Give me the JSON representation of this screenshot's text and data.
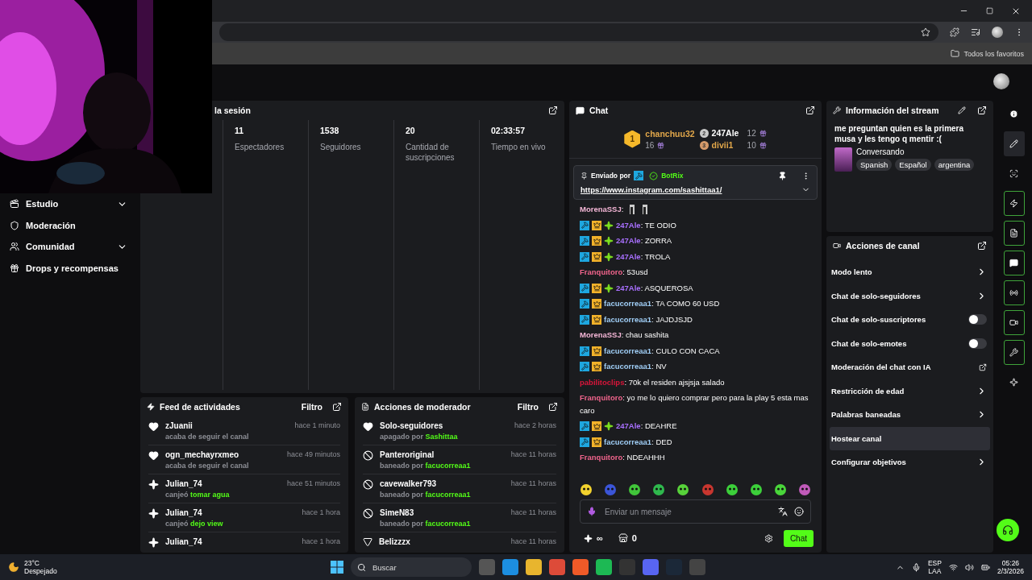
{
  "browser": {
    "bookmark": "Todos los favoritos"
  },
  "sidebar": {
    "items": [
      {
        "label": "Estudio",
        "kind": "group"
      },
      {
        "label": "Moderación",
        "kind": "link"
      },
      {
        "label": "Comunidad",
        "kind": "group"
      },
      {
        "label": "Drops y recompensas",
        "kind": "link"
      }
    ]
  },
  "stats": {
    "title": "la sesión",
    "items": [
      {
        "value": "11",
        "label": "Espectadores"
      },
      {
        "value": "1538",
        "label": "Seguidores"
      },
      {
        "value": "20",
        "label": "Cantidad de suscripciones"
      },
      {
        "value": "02:33:57",
        "label": "Tiempo en vivo"
      }
    ]
  },
  "feed": {
    "title": "Feed de actividades",
    "filter": "Filtro",
    "items": [
      {
        "kind": "follow",
        "user": "zJuanii",
        "time": "hace 1 minuto",
        "action": "acaba de seguir el canal"
      },
      {
        "kind": "follow",
        "user": "ogn_mechayrxmeo",
        "time": "hace 49 minutos",
        "action": "acaba de seguir el canal"
      },
      {
        "kind": "redeem",
        "user": "Julian_74",
        "time": "hace 51 minutos",
        "action": "canjeó",
        "target": "tomar agua"
      },
      {
        "kind": "redeem",
        "user": "Julian_74",
        "time": "hace 1 hora",
        "action": "canjeó",
        "target": "dejo view"
      },
      {
        "kind": "redeem",
        "user": "Julian_74",
        "time": "hace 1 hora"
      }
    ]
  },
  "mod_actions": {
    "title": "Acciones de moderador",
    "filter": "Filtro",
    "items": [
      {
        "kind": "follow",
        "user": "Solo-seguidores",
        "time": "hace 2 horas",
        "action": "apagado por",
        "target": "Sashittaa"
      },
      {
        "kind": "ban",
        "user": "Panteroriginal",
        "time": "hace 11 horas",
        "action": "baneado por",
        "target": "facucorreaa1"
      },
      {
        "kind": "ban",
        "user": "cavewalker793",
        "time": "hace 11 horas",
        "action": "baneado por",
        "target": "facucorreaa1"
      },
      {
        "kind": "ban",
        "user": "SimeN83",
        "time": "hace 11 horas",
        "action": "baneado por",
        "target": "facucorreaa1"
      },
      {
        "kind": "unban",
        "user": "Belizzzx",
        "time": "hace 11 horas"
      }
    ]
  },
  "chat": {
    "title": "Chat",
    "leaders": [
      {
        "rank": "1",
        "name": "chanchuu32",
        "count": "16",
        "color": "#f5b82a"
      },
      {
        "rank": "2",
        "name": "247Ale",
        "count": "12",
        "color": "#c9c9c9"
      },
      {
        "rank": "3",
        "name": "divii1",
        "count": "10",
        "color": "#d59a6a"
      }
    ],
    "pinned": {
      "label": "Enviado por",
      "sender": "BotRix",
      "link": "https://www.instagram.com/sashittaa1/"
    },
    "messages": [
      {
        "user": "MorenaSSJ",
        "color": "#f4b6d6",
        "kind": "emote",
        "text": ":"
      },
      {
        "user": "247Ale",
        "color": "#a970ff",
        "kind": "ally",
        "text": ": TE ODIO"
      },
      {
        "user": "247Ale",
        "color": "#a970ff",
        "kind": "ally",
        "text": ": ZORRA"
      },
      {
        "user": "247Ale",
        "color": "#a970ff",
        "kind": "ally",
        "text": ": TROLA"
      },
      {
        "user": "Franquitoro",
        "color": "#f0648c",
        "kind": "viewer",
        "text": ": 53usd"
      },
      {
        "user": "247Ale",
        "color": "#a970ff",
        "kind": "ally",
        "text": ": ASQUEROSA"
      },
      {
        "user": "facucorreaa1",
        "color": "#9fcdf5",
        "kind": "mod",
        "text": ": TA COMO 60 USD"
      },
      {
        "user": "facucorreaa1",
        "color": "#9fcdf5",
        "kind": "mod",
        "text": ": JAJDJSJD"
      },
      {
        "user": "MorenaSSJ",
        "color": "#f4b6d6",
        "kind": "viewer",
        "text": ": chau sashita"
      },
      {
        "user": "facucorreaa1",
        "color": "#9fcdf5",
        "kind": "mod",
        "text": ": CULO CON CACA"
      },
      {
        "user": "facucorreaa1",
        "color": "#9fcdf5",
        "kind": "mod",
        "text": ": NV"
      },
      {
        "user": "pabilitoclips",
        "color": "#d8153a",
        "kind": "viewer",
        "text": ": 70k el residen ajsjsja salado"
      },
      {
        "user": "Franquitoro",
        "color": "#f0648c",
        "kind": "viewer",
        "text": ": yo me lo quiero comprar pero para la play 5 esta mas caro"
      },
      {
        "user": "247Ale",
        "color": "#a970ff",
        "kind": "ally",
        "text": ": DEAHRE"
      },
      {
        "user": "facucorreaa1",
        "color": "#9fcdf5",
        "kind": "mod",
        "text": ": DED"
      },
      {
        "user": "Franquitoro",
        "color": "#f0648c",
        "kind": "viewer",
        "text": ": NDEAHHH"
      }
    ],
    "input": {
      "placeholder": "Enviar un mensaje"
    },
    "points": "∞",
    "store_count": "0",
    "send": "Chat"
  },
  "stream_info": {
    "title": "Información del stream",
    "stream_title": "me preguntan quien es la primera musa y les tengo q mentir :(",
    "category": "Conversando",
    "tags": [
      "Spanish",
      "Español",
      "argentina"
    ]
  },
  "channel_actions": {
    "title": "Acciones de canal",
    "items": [
      {
        "label": "Modo lento",
        "kind": "arrow",
        "highlighted": false
      },
      {
        "label": "Chat de solo-seguidores",
        "kind": "arrow",
        "highlighted": false
      },
      {
        "label": "Chat de solo-suscriptores",
        "kind": "toggle",
        "on": false,
        "highlighted": false
      },
      {
        "label": "Chat de solo-emotes",
        "kind": "toggle",
        "on": false,
        "highlighted": false
      },
      {
        "label": "Moderación del chat con IA",
        "kind": "external",
        "highlighted": false
      },
      {
        "label": "Restricción de edad",
        "kind": "arrow",
        "highlighted": false
      },
      {
        "label": "Palabras baneadas",
        "kind": "arrow",
        "highlighted": false
      },
      {
        "label": "Hostear canal",
        "kind": "plain",
        "highlighted": true
      },
      {
        "label": "Configurar objetivos",
        "kind": "arrow",
        "highlighted": false
      }
    ]
  },
  "rail": [
    {
      "kind": "info",
      "active": false,
      "selected": false
    },
    {
      "kind": "edit",
      "active": false,
      "selected": true
    },
    {
      "kind": "capture",
      "active": false,
      "selected": false
    },
    {
      "kind": "feed",
      "active": true,
      "selected": false
    },
    {
      "kind": "log",
      "active": true,
      "selected": false
    },
    {
      "kind": "chat",
      "active": true,
      "selected": false
    },
    {
      "kind": "broadcast",
      "active": true,
      "selected": false
    },
    {
      "kind": "video",
      "active": true,
      "selected": false
    },
    {
      "kind": "tools",
      "active": true,
      "selected": false
    },
    {
      "kind": "points",
      "active": false,
      "selected": false
    }
  ],
  "taskbar": {
    "temp": "23°C",
    "weather": "Despejado",
    "search": {
      "placeholder": "Buscar"
    },
    "lang": "ESP",
    "layout": "LAA",
    "time": "05:26",
    "date": "2/3/2026"
  }
}
